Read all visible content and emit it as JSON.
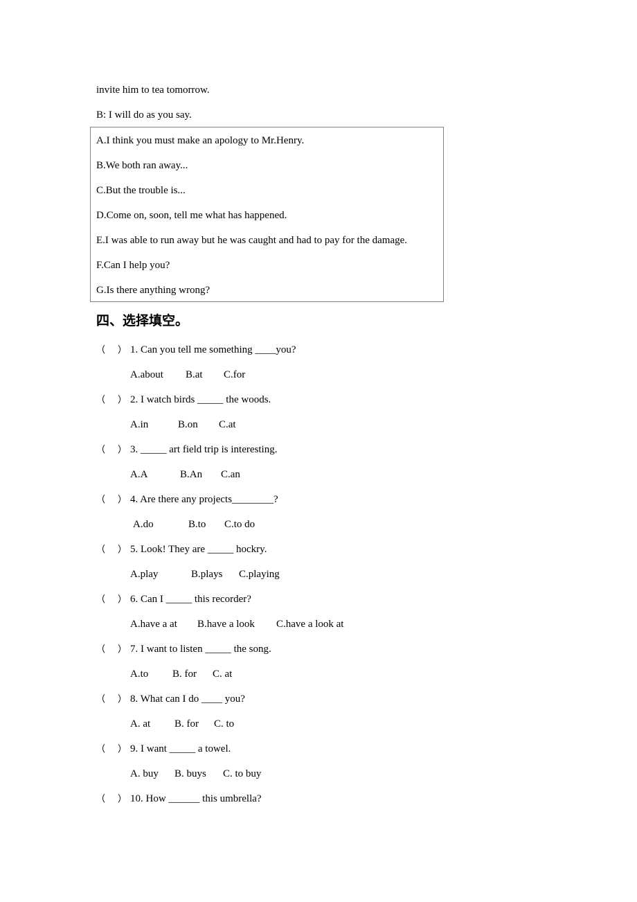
{
  "dialogue_tail": [
    "invite him to tea tomorrow.",
    "B: I will do as you say."
  ],
  "option_box": [
    "A.I think you must make an apology to Mr.Henry.",
    "B.We both ran away...",
    "C.But the trouble is...",
    "D.Come on, soon, tell me what has happened.",
    "E.I was able to run away but he was caught and had to pay for the damage.",
    "F.Can I help you?",
    "G.Is there anything wrong?"
  ],
  "section": {
    "heading": "四、选择填空。",
    "paren_open": "（",
    "paren_close": "）",
    "questions": [
      {
        "text": "1. Can you tell me something ____you?",
        "options": [
          "A.about",
          "B.at",
          "C.for"
        ]
      },
      {
        "text": "2. I watch birds _____ the woods.",
        "options": [
          "A.in",
          "B.on",
          "C.at"
        ]
      },
      {
        "text": "3. _____ art field trip is interesting.",
        "options": [
          "A.A",
          "B.An",
          "C.an"
        ]
      },
      {
        "text": "4. Are there any projects________?",
        "options": [
          "A.do",
          "B.to",
          "C.to do"
        ]
      },
      {
        "text": "5. Look! They are _____ hockry.",
        "options": [
          "A.play",
          "B.plays",
          "C.playing"
        ]
      },
      {
        "text": "6. Can I _____ this recorder?",
        "options": [
          "A.have a at",
          "B.have a look",
          "C.have a look at"
        ]
      },
      {
        "text": "7. I want to listen _____ the song.",
        "options": [
          "A.to",
          "B. for",
          "C. at"
        ]
      },
      {
        "text": "8. What can I do ____ you?",
        "options": [
          "A. at",
          "B. for",
          "C. to"
        ]
      },
      {
        "text": "9. I want _____ a towel.",
        "options": [
          "A. buy",
          "B. buys",
          "C. to buy"
        ]
      },
      {
        "text": "10. How ______ this umbrella?",
        "options": []
      }
    ]
  }
}
